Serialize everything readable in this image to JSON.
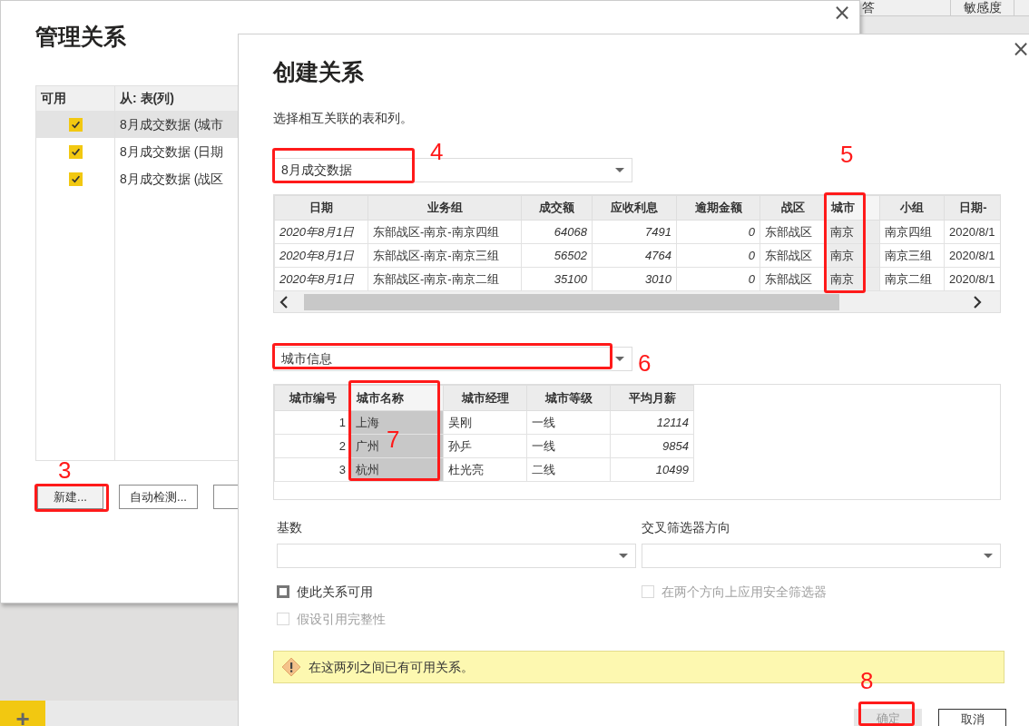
{
  "background_panel": {
    "columns": [
      "答",
      "敏感度"
    ]
  },
  "manage_dialog": {
    "title": "管理关系",
    "close": "×",
    "columns": [
      "可用",
      "从: 表(列)"
    ],
    "rows": [
      {
        "checked": true,
        "selected": true,
        "from": "8月成交数据 (城市"
      },
      {
        "checked": true,
        "selected": false,
        "from": "8月成交数据 (日期"
      },
      {
        "checked": true,
        "selected": false,
        "from": "8月成交数据 (战区"
      }
    ],
    "buttons": [
      "新建...",
      "自动检测..."
    ]
  },
  "page_tabs": {
    "add": "+"
  },
  "create_dialog": {
    "title": "创建关系",
    "close": "×",
    "subtitle": "选择相互关联的表和列。",
    "table_1": {
      "value": "8月成交数据",
      "columns": [
        {
          "label": "日期",
          "selected": false
        },
        {
          "label": "业务组",
          "selected": false
        },
        {
          "label": "成交额",
          "selected": false
        },
        {
          "label": "应收利息",
          "selected": false
        },
        {
          "label": "逾期金额",
          "selected": false
        },
        {
          "label": "战区",
          "selected": false
        },
        {
          "label": "城市",
          "selected": true
        },
        {
          "label": "小组",
          "selected": false
        },
        {
          "label": "日期-",
          "selected": false
        }
      ],
      "rows": [
        [
          "2020年8月1日",
          "东部战区-南京-南京四组",
          "64068",
          "7491",
          "0",
          "东部战区",
          "南京",
          "南京四组",
          "2020/8/1"
        ],
        [
          "2020年8月1日",
          "东部战区-南京-南京三组",
          "56502",
          "4764",
          "0",
          "东部战区",
          "南京",
          "南京三组",
          "2020/8/1"
        ],
        [
          "2020年8月1日",
          "东部战区-南京-南京二组",
          "35100",
          "3010",
          "0",
          "东部战区",
          "南京",
          "南京二组",
          "2020/8/1"
        ]
      ]
    },
    "table_2": {
      "value": "城市信息",
      "columns": [
        {
          "label": "城市编号",
          "selected": false
        },
        {
          "label": "城市名称",
          "selected": true
        },
        {
          "label": "城市经理",
          "selected": false
        },
        {
          "label": "城市等级",
          "selected": false
        },
        {
          "label": "平均月薪",
          "selected": false
        }
      ],
      "rows": [
        [
          "1",
          "上海",
          "吴刚",
          "一线",
          "12114"
        ],
        [
          "2",
          "广州",
          "孙乒",
          "一线",
          "9854"
        ],
        [
          "3",
          "杭州",
          "杜光亮",
          "二线",
          "10499"
        ]
      ]
    },
    "cardinality": {
      "label": "基数"
    },
    "cross_filter": {
      "label": "交叉筛选器方向"
    },
    "options": [
      {
        "label": "使此关系可用",
        "checked": false,
        "disabled": false
      },
      {
        "label": "在两个方向上应用安全筛选器",
        "checked": false,
        "disabled": true
      },
      {
        "label": "假设引用完整性",
        "checked": false,
        "disabled": true
      }
    ],
    "warning": "在这两列之间已有可用关系。",
    "buttons": [
      {
        "label": "确定",
        "disabled": true
      },
      {
        "label": "取消",
        "disabled": false
      }
    ]
  },
  "annotations": [
    {
      "label": "3"
    },
    {
      "label": "4"
    },
    {
      "label": "5"
    },
    {
      "label": "6"
    },
    {
      "label": "7"
    },
    {
      "label": "8"
    }
  ]
}
